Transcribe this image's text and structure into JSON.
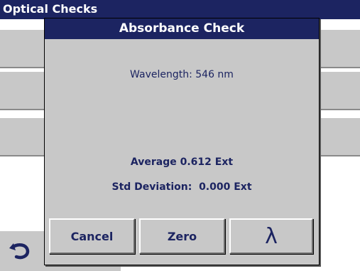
{
  "background": {
    "title": "Optical Checks"
  },
  "dialog": {
    "title": "Absorbance Check",
    "wavelength": "Wavelength: 546 nm",
    "average": "Average 0.612 Ext",
    "std_deviation": "Std Deviation:  0.000 Ext",
    "buttons": {
      "cancel": "Cancel",
      "zero": "Zero",
      "lambda": "λ"
    }
  },
  "icons": {
    "back": "back-arrow-icon"
  },
  "colors": {
    "title_bar": "#1c2461",
    "panel": "#c8c8c8",
    "text": "#1c2461"
  }
}
